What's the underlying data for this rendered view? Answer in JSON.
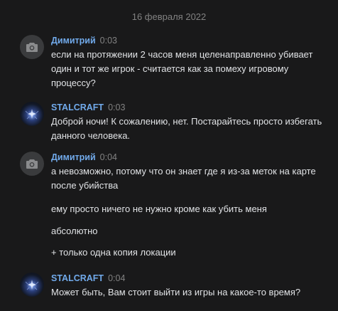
{
  "date_separator": "16 февраля 2022",
  "colors": {
    "background": "#19191a",
    "author": "#71aaeb",
    "timestamp": "#828282",
    "text": "#e1e3e6"
  },
  "messages": [
    {
      "author": "Димитрий",
      "time": "0:03",
      "avatar_icon": "camera-icon",
      "lines": [
        "если на протяжении 2 часов меня целенаправленно убивает один и тот же игрок - считается как за помеху игровому процессу?"
      ]
    },
    {
      "author": "STALCRAFT",
      "time": "0:03",
      "avatar_icon": "stalcraft-logo",
      "lines": [
        "Доброй ночи! К сожалению, нет. Постарайтесь просто избегать данного человека."
      ]
    },
    {
      "author": "Димитрий",
      "time": "0:04",
      "avatar_icon": "camera-icon",
      "lines": [
        "а невозможно, потому что он знает где я из-за меток на карте после убийства",
        "ему просто ничего не нужно кроме как убить меня",
        "абсолютно",
        "+ только одна копия локации"
      ]
    },
    {
      "author": "STALCRAFT",
      "time": "0:04",
      "avatar_icon": "stalcraft-logo",
      "lines": [
        "Может быть, Вам стоит выйти из игры на какое-то время?"
      ]
    }
  ]
}
